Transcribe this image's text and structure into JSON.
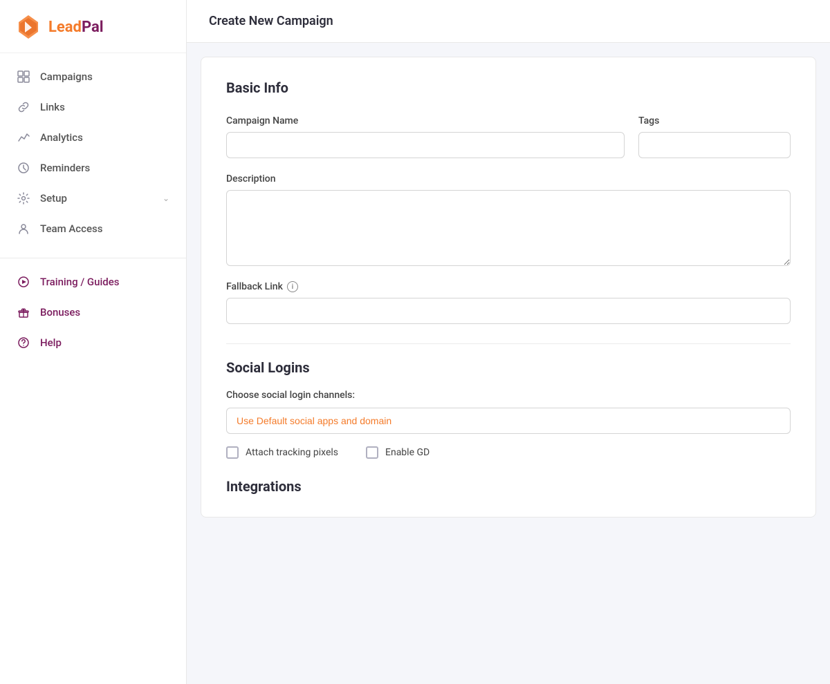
{
  "brand": {
    "lead": "Lead",
    "pal": "Pal"
  },
  "sidebar": {
    "primary_items": [
      {
        "id": "campaigns",
        "label": "Campaigns",
        "icon": "grid"
      },
      {
        "id": "links",
        "label": "Links",
        "icon": "link"
      },
      {
        "id": "analytics",
        "label": "Analytics",
        "icon": "analytics"
      },
      {
        "id": "reminders",
        "label": "Reminders",
        "icon": "clock"
      },
      {
        "id": "setup",
        "label": "Setup",
        "icon": "gear",
        "has_chevron": true
      },
      {
        "id": "team-access",
        "label": "Team Access",
        "icon": "person"
      }
    ],
    "secondary_items": [
      {
        "id": "training-guides",
        "label": "Training / Guides",
        "icon": "play-circle"
      },
      {
        "id": "bonuses",
        "label": "Bonuses",
        "icon": "gift"
      },
      {
        "id": "help",
        "label": "Help",
        "icon": "help-circle"
      }
    ]
  },
  "page": {
    "header_title": "Create New Campaign"
  },
  "form": {
    "basic_info_title": "Basic Info",
    "campaign_name_label": "Campaign Name",
    "campaign_name_placeholder": "",
    "tags_label": "Tags",
    "tags_placeholder": "",
    "description_label": "Description",
    "description_placeholder": "",
    "fallback_link_label": "Fallback Link",
    "fallback_link_placeholder": "",
    "social_logins_title": "Social Logins",
    "social_channels_label": "Choose social login channels:",
    "social_channels_default": "Use Default social apps and domain",
    "attach_pixels_label": "Attach tracking pixels",
    "enable_gdpr_label": "Enable GD",
    "integrations_title": "Integrations"
  }
}
